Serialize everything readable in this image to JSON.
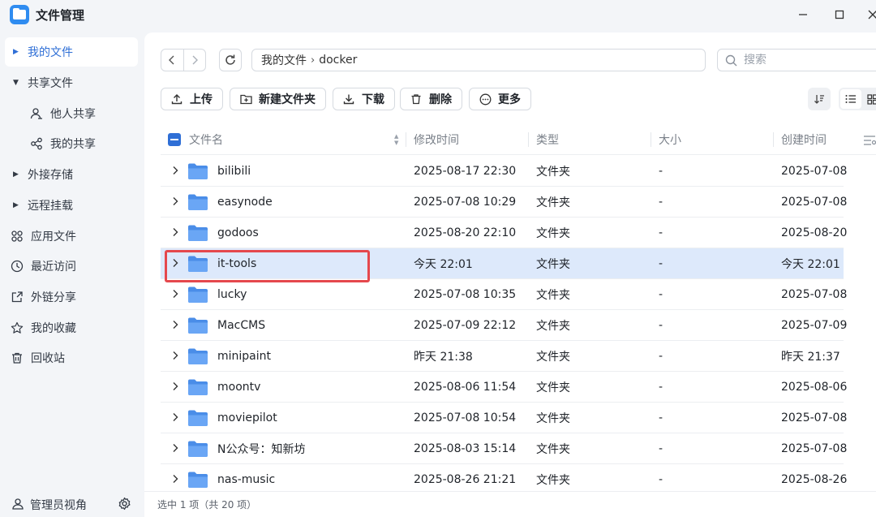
{
  "window": {
    "title": "文件管理"
  },
  "sidebar": {
    "items": [
      {
        "label": "我的文件",
        "icon": "caret-right-icon",
        "active": true
      },
      {
        "label": "共享文件",
        "icon": "caret-down-icon"
      },
      {
        "label": "他人共享",
        "icon": "user-share-icon"
      },
      {
        "label": "我的共享",
        "icon": "share-icon"
      },
      {
        "label": "外接存储",
        "icon": "caret-right-icon"
      },
      {
        "label": "远程挂载",
        "icon": "caret-right-icon"
      },
      {
        "label": "应用文件",
        "icon": "apps-icon"
      },
      {
        "label": "最近访问",
        "icon": "clock-icon"
      },
      {
        "label": "外链分享",
        "icon": "external-link-icon"
      },
      {
        "label": "我的收藏",
        "icon": "star-icon"
      },
      {
        "label": "回收站",
        "icon": "trash-icon"
      }
    ],
    "footer": {
      "label": "管理员视角"
    }
  },
  "path": {
    "parts": [
      "我的文件",
      "docker"
    ],
    "separator": "›"
  },
  "search": {
    "placeholder": "搜索"
  },
  "toolbar": {
    "upload": "上传",
    "new_folder": "新建文件夹",
    "download": "下载",
    "delete": "删除",
    "more": "更多"
  },
  "table": {
    "columns": {
      "name": "文件名",
      "modified": "修改时间",
      "type": "类型",
      "size": "大小",
      "created": "创建时间"
    },
    "rows": [
      {
        "name": "bilibili",
        "modified": "2025-08-17 22:30",
        "type": "文件夹",
        "size": "-",
        "created": "2025-07-08"
      },
      {
        "name": "easynode",
        "modified": "2025-07-08 10:29",
        "type": "文件夹",
        "size": "-",
        "created": "2025-07-08"
      },
      {
        "name": "godoos",
        "modified": "2025-08-20 22:10",
        "type": "文件夹",
        "size": "-",
        "created": "2025-08-20"
      },
      {
        "name": "it-tools",
        "modified": "今天 22:01",
        "type": "文件夹",
        "size": "-",
        "created": "今天 22:01",
        "selected": true
      },
      {
        "name": "lucky",
        "modified": "2025-07-08 10:35",
        "type": "文件夹",
        "size": "-",
        "created": "2025-07-08"
      },
      {
        "name": "MacCMS",
        "modified": "2025-07-09 22:12",
        "type": "文件夹",
        "size": "-",
        "created": "2025-07-09"
      },
      {
        "name": "minipaint",
        "modified": "昨天 21:38",
        "type": "文件夹",
        "size": "-",
        "created": "昨天 21:37"
      },
      {
        "name": "moontv",
        "modified": "2025-08-06 11:54",
        "type": "文件夹",
        "size": "-",
        "created": "2025-08-06"
      },
      {
        "name": "moviepilot",
        "modified": "2025-07-08 10:54",
        "type": "文件夹",
        "size": "-",
        "created": "2025-07-08"
      },
      {
        "name": "N公众号：知新坊",
        "modified": "2025-08-03 15:14",
        "type": "文件夹",
        "size": "-",
        "created": "2025-07-08"
      },
      {
        "name": "nas-music",
        "modified": "2025-08-26 21:21",
        "type": "文件夹",
        "size": "-",
        "created": "2025-08-26"
      }
    ]
  },
  "status": {
    "text": "选中 1 项（共 20 项）"
  },
  "colors": {
    "accent": "#2f6fd6",
    "selected_row": "#dde9fb",
    "folder": "#5b9cf2",
    "highlight": "#e5484d"
  }
}
